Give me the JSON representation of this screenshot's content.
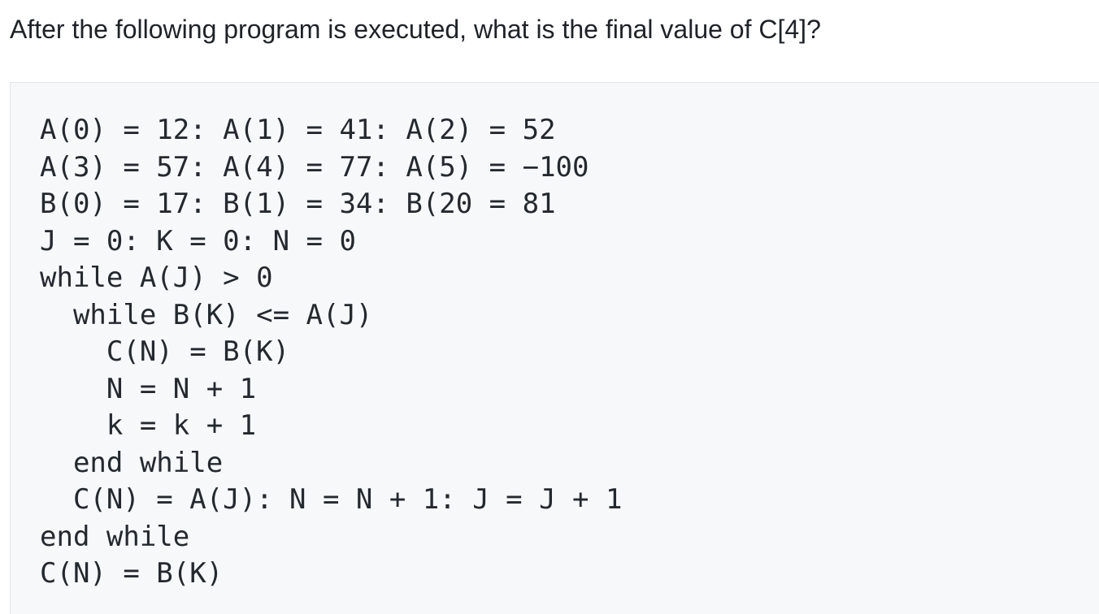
{
  "question": {
    "text": "After the following program is executed, what is the final value of C[4]?"
  },
  "code": {
    "lines": [
      "A(0) = 12: A(1) = 41: A(2) = 52",
      "A(3) = 57: A(4) = 77: A(5) = −100",
      "B(0) = 17: B(1) = 34: B(20 = 81",
      "J = 0: K = 0: N = 0",
      "while A(J) > 0",
      "  while B(K) <= A(J)",
      "    C(N) = B(K)",
      "    N = N + 1",
      "    k = k + 1",
      "  end while",
      "  C(N) = A(J): N = N + 1: J = J + 1",
      "end while",
      "C(N) = B(K)"
    ]
  }
}
